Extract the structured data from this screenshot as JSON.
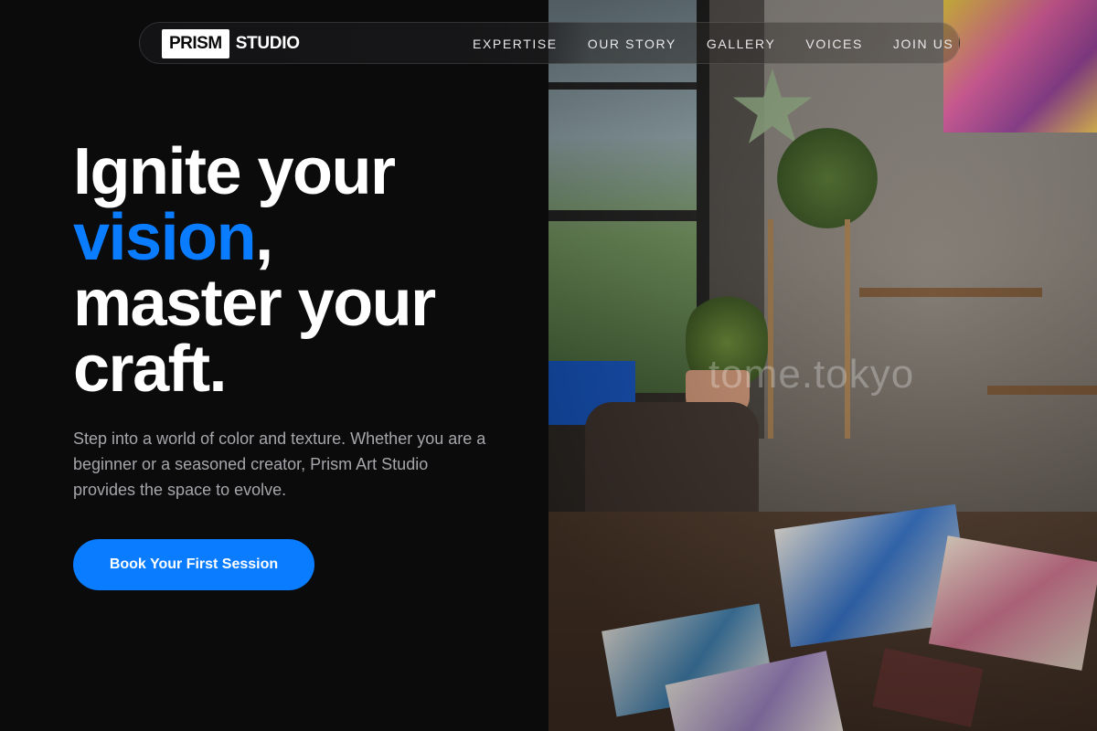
{
  "nav": {
    "logo_box": "PRISM",
    "logo_text": "STUDIO",
    "links": [
      "EXPERTISE",
      "OUR STORY",
      "GALLERY",
      "VOICES",
      "JOIN US"
    ]
  },
  "hero": {
    "line1": "Ignite your",
    "line2_accent": "vision",
    "line2_rest": ",",
    "line3": "master your",
    "line4": "craft.",
    "subtitle": "Step into a world of color and texture. Whether you are a beginner or a seasoned creator, Prism Art Studio provides the space to evolve.",
    "cta_label": "Book Your First Session"
  },
  "image": {
    "watermark": "tome.tokyo"
  },
  "colors": {
    "accent": "#0a7cff",
    "background": "#0b0b0c",
    "text": "#ffffff",
    "muted": "#a6a6ab"
  }
}
